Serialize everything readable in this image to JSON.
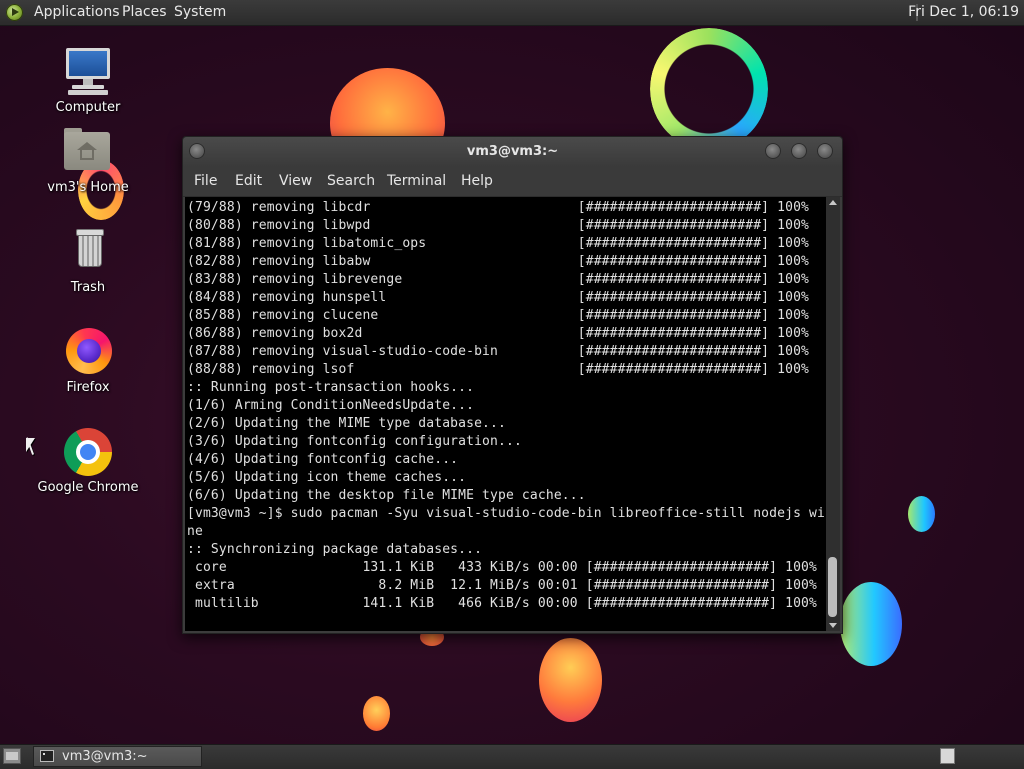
{
  "top_panel": {
    "menus": [
      "Applications",
      "Places",
      "System"
    ],
    "clock": "Fri Dec 1, 06:19",
    "logo_icon": "mate-logo-icon"
  },
  "desktop_icons": [
    {
      "label": "Computer",
      "icon": "computer-icon"
    },
    {
      "label": "vm3's Home",
      "icon": "home-folder-icon"
    },
    {
      "label": "Trash",
      "icon": "trash-icon"
    },
    {
      "label": "Firefox",
      "icon": "firefox-icon"
    },
    {
      "label": "Google Chrome",
      "icon": "chrome-icon"
    }
  ],
  "terminal": {
    "title": "vm3@vm3:~",
    "menu": [
      "File",
      "Edit",
      "View",
      "Search",
      "Terminal",
      "Help"
    ],
    "lines": [
      "(79/88) removing libcdr                          [######################] 100%",
      "(80/88) removing libwpd                          [######################] 100%",
      "(81/88) removing libatomic_ops                   [######################] 100%",
      "(82/88) removing libabw                          [######################] 100%",
      "(83/88) removing librevenge                      [######################] 100%",
      "(84/88) removing hunspell                        [######################] 100%",
      "(85/88) removing clucene                         [######################] 100%",
      "(86/88) removing box2d                           [######################] 100%",
      "(87/88) removing visual-studio-code-bin          [######################] 100%",
      "(88/88) removing lsof                            [######################] 100%",
      ":: Running post-transaction hooks...",
      "(1/6) Arming ConditionNeedsUpdate...",
      "(2/6) Updating the MIME type database...",
      "(3/6) Updating fontconfig configuration...",
      "(4/6) Updating fontconfig cache...",
      "(5/6) Updating icon theme caches...",
      "(6/6) Updating the desktop file MIME type cache...",
      "[vm3@vm3 ~]$ sudo pacman -Syu visual-studio-code-bin libreoffice-still nodejs wi",
      "ne",
      ":: Synchronizing package databases...",
      " core                 131.1 KiB   433 KiB/s 00:00 [######################] 100%",
      " extra                  8.2 MiB  12.1 MiB/s 00:01 [######################] 100%",
      " multilib             141.1 KiB   466 KiB/s 00:00 [######################] 100%"
    ]
  },
  "bottom_panel": {
    "task_label": "vm3@vm3:~",
    "show_desktop_icon": "show-desktop-icon",
    "workspace_icon": "workspace-switcher-icon"
  }
}
